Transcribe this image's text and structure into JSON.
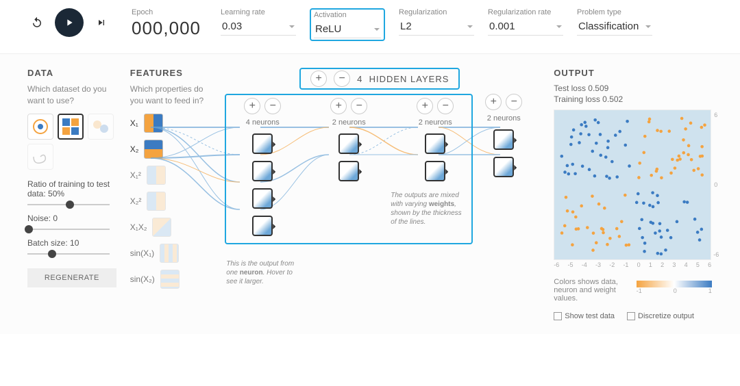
{
  "params": {
    "epoch_label": "Epoch",
    "epoch_value": "000,000",
    "lr_label": "Learning rate",
    "lr_value": "0.03",
    "act_label": "Activation",
    "act_value": "ReLU",
    "reg_label": "Regularization",
    "reg_value": "L2",
    "regrate_label": "Regularization rate",
    "regrate_value": "0.001",
    "prob_label": "Problem type",
    "prob_value": "Classification"
  },
  "data_panel": {
    "title": "DATA",
    "subtitle": "Which dataset do you want to use?",
    "ratio_label": "Ratio of training to test data:  50%",
    "noise_label": "Noise:  0",
    "batch_label": "Batch size:  10",
    "regen": "REGENERATE"
  },
  "features_panel": {
    "title": "FEATURES",
    "subtitle": "Which properties do you want to feed in?",
    "items": [
      "X₁",
      "X₂",
      "X₁²",
      "X₂²",
      "X₁X₂",
      "sin(X₁)",
      "sin(X₂)"
    ]
  },
  "network": {
    "layers_count": "4",
    "layers_label": "HIDDEN LAYERS",
    "layer_neurons": [
      "4 neurons",
      "2 neurons",
      "2 neurons",
      "2 neurons"
    ],
    "ann1": "This is the output from one neuron. Hover to see it larger.",
    "ann2": "The outputs are mixed with varying weights, shown by the thickness of the lines."
  },
  "output": {
    "title": "OUTPUT",
    "test_loss": "Test loss 0.509",
    "train_loss": "Training loss 0.502",
    "legend_text": "Colors shows data, neuron and weight values.",
    "grad_min": "-1",
    "grad_mid": "0",
    "grad_max": "1",
    "show_test": "Show test data",
    "discretize": "Discretize output",
    "axis_ticks": [
      "-6",
      "-5",
      "-4",
      "-3",
      "-2",
      "-1",
      "0",
      "1",
      "2",
      "3",
      "4",
      "5",
      "6"
    ]
  },
  "chart_data": {
    "type": "scatter",
    "title": "",
    "xlabel": "",
    "ylabel": "",
    "xlim": [
      -6,
      6
    ],
    "ylim": [
      -6,
      6
    ],
    "series": [
      {
        "name": "class-orange",
        "color": "#f4a340",
        "points_approx": 120
      },
      {
        "name": "class-blue",
        "color": "#3b7bc2",
        "points_approx": 130
      }
    ],
    "note": "Two-class exclusive-or style scatter; background decision region light blue"
  }
}
